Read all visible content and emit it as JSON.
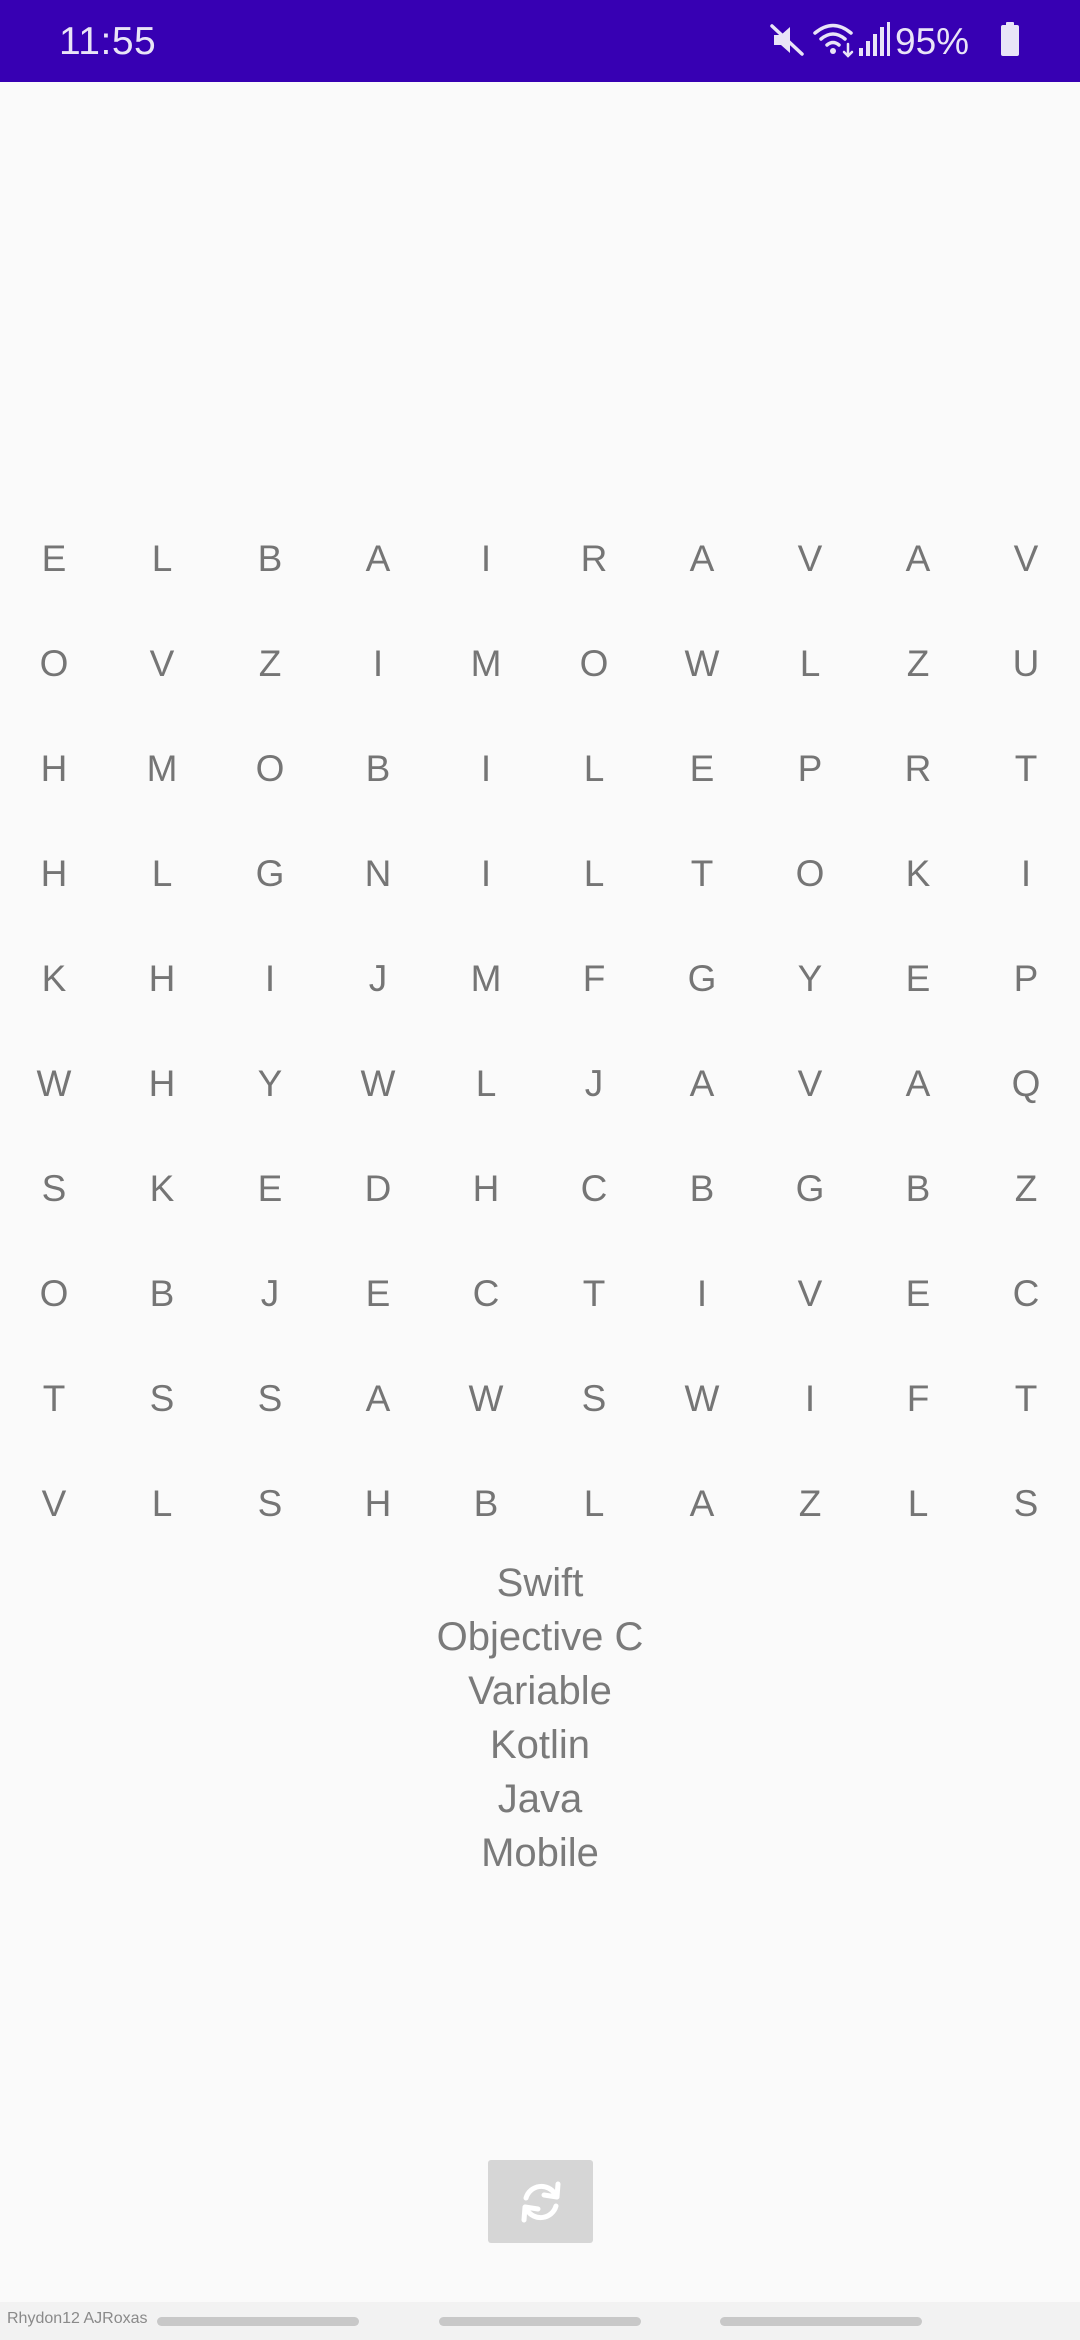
{
  "status_bar": {
    "time": "11:55",
    "battery_percent": "95%",
    "icons": [
      "mute-icon",
      "wifi-icon",
      "signal-icon",
      "battery-icon"
    ],
    "background_color": "#3700B3"
  },
  "grid": [
    [
      "E",
      "L",
      "B",
      "A",
      "I",
      "R",
      "A",
      "V",
      "A",
      "V"
    ],
    [
      "O",
      "V",
      "Z",
      "I",
      "M",
      "O",
      "W",
      "L",
      "Z",
      "U"
    ],
    [
      "H",
      "M",
      "O",
      "B",
      "I",
      "L",
      "E",
      "P",
      "R",
      "T"
    ],
    [
      "H",
      "L",
      "G",
      "N",
      "I",
      "L",
      "T",
      "O",
      "K",
      "I"
    ],
    [
      "K",
      "H",
      "I",
      "J",
      "M",
      "F",
      "G",
      "Y",
      "E",
      "P"
    ],
    [
      "W",
      "H",
      "Y",
      "W",
      "L",
      "J",
      "A",
      "V",
      "A",
      "Q"
    ],
    [
      "S",
      "K",
      "E",
      "D",
      "H",
      "C",
      "B",
      "G",
      "B",
      "Z"
    ],
    [
      "O",
      "B",
      "J",
      "E",
      "C",
      "T",
      "I",
      "V",
      "E",
      "C"
    ],
    [
      "T",
      "S",
      "S",
      "A",
      "W",
      "S",
      "W",
      "I",
      "F",
      "T"
    ],
    [
      "V",
      "L",
      "S",
      "H",
      "B",
      "L",
      "A",
      "Z",
      "L",
      "S"
    ]
  ],
  "words": [
    "Swift",
    "Objective C",
    "Variable",
    "Kotlin",
    "Java",
    "Mobile"
  ],
  "refresh_button": {
    "icon": "refresh-icon"
  },
  "watermark": "Rhydon12 AJRoxas"
}
